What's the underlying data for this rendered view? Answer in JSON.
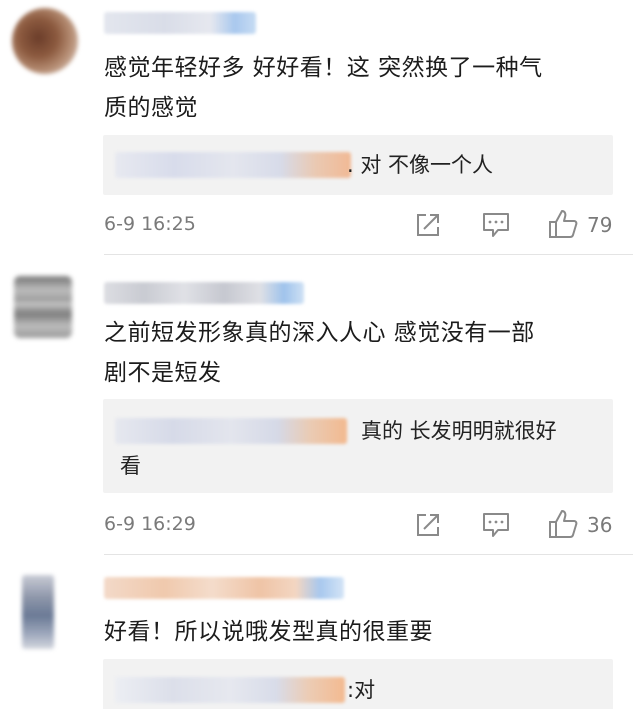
{
  "comments": [
    {
      "text_line1": "感觉年轻好多 好好看！这 突然换了一种气",
      "text_line2": "质的感觉",
      "reply": ". 对 不像一个人",
      "time": "6-9 16:25",
      "likes": "79"
    },
    {
      "text_line1": "之前短发形象真的深入人心 感觉没有一部",
      "text_line2": "剧不是短发",
      "reply_line1": "真的 长发明明就很好",
      "reply_line2": "看",
      "time": "6-9 16:29",
      "likes": "36"
    },
    {
      "text_line1": "好看！所以说哦发型真的很重要",
      "reply": ":对"
    }
  ],
  "icons": {
    "share": "share-icon",
    "comment": "comment-icon",
    "like": "thumbs-up-icon"
  }
}
